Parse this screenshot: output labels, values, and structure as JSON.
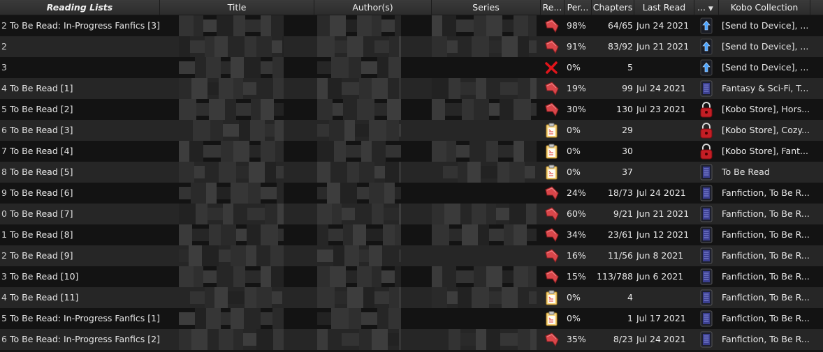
{
  "columns": {
    "reading_lists": "Reading Lists",
    "title": "Title",
    "authors": "Author(s)",
    "series": "Series",
    "read": "Re...",
    "percent": "Per...",
    "chapters": "Chapters",
    "last_read": "Last Read",
    "device": "...",
    "collection": "Kobo Collection"
  },
  "rows": [
    {
      "num": "2",
      "list": "To Be Read: In-Progress Fanfics [3]",
      "status": "bookmark",
      "percent": "98%",
      "chapters": "64/65",
      "last_read": "Jun 24 2021",
      "device": "send",
      "collection": "[Send to Device], ..."
    },
    {
      "num": "2",
      "list": "",
      "status": "bookmark",
      "percent": "91%",
      "chapters": "83/92",
      "last_read": "Jun 21 2021",
      "device": "send",
      "collection": "[Send to Device], ..."
    },
    {
      "num": "3",
      "list": "",
      "status": "cross",
      "percent": "0%",
      "chapters": "5",
      "last_read": "",
      "device": "send",
      "collection": "[Send to Device], ..."
    },
    {
      "num": "4",
      "list": "To Be Read [1]",
      "status": "bookmark",
      "percent": "19%",
      "chapters": "99",
      "last_read": "Jul 24 2021",
      "device": "ereader",
      "collection": "Fantasy & Sci-Fi, T..."
    },
    {
      "num": "5",
      "list": "To Be Read [2]",
      "status": "bookmark",
      "percent": "30%",
      "chapters": "130",
      "last_read": "Jul 23 2021",
      "device": "lock",
      "collection": "[Kobo Store], Hors..."
    },
    {
      "num": "6",
      "list": "To Be Read [3]",
      "status": "clipboard",
      "percent": "0%",
      "chapters": "29",
      "last_read": "",
      "device": "lock",
      "collection": "[Kobo Store], Cozy..."
    },
    {
      "num": "7",
      "list": "To Be Read [4]",
      "status": "clipboard",
      "percent": "0%",
      "chapters": "30",
      "last_read": "",
      "device": "lock",
      "collection": "[Kobo Store], Fant..."
    },
    {
      "num": "8",
      "list": "To Be Read [5]",
      "status": "clipboard",
      "percent": "0%",
      "chapters": "37",
      "last_read": "",
      "device": "ereader",
      "collection": "To Be Read"
    },
    {
      "num": "9",
      "list": "To Be Read [6]",
      "status": "bookmark",
      "percent": "24%",
      "chapters": "18/73",
      "last_read": "Jul 24 2021",
      "device": "ereader",
      "collection": "Fanfiction, To Be R..."
    },
    {
      "num": "0",
      "list": "To Be Read [7]",
      "status": "bookmark",
      "percent": "60%",
      "chapters": "9/21",
      "last_read": "Jun 21 2021",
      "device": "ereader",
      "collection": "Fanfiction, To Be R..."
    },
    {
      "num": "1",
      "list": "To Be Read [8]",
      "status": "bookmark",
      "percent": "34%",
      "chapters": "23/61",
      "last_read": "Jun 12 2021",
      "device": "ereader",
      "collection": "Fanfiction, To Be R..."
    },
    {
      "num": "2",
      "list": "To Be Read [9]",
      "status": "bookmark",
      "percent": "16%",
      "chapters": "11/56",
      "last_read": "Jun 8 2021",
      "device": "ereader",
      "collection": "Fanfiction, To Be R..."
    },
    {
      "num": "3",
      "list": "To Be Read [10]",
      "status": "bookmark",
      "percent": "15%",
      "chapters": "113/788",
      "last_read": "Jun 6 2021",
      "device": "ereader",
      "collection": "Fanfiction, To Be R..."
    },
    {
      "num": "4",
      "list": "To Be Read [11]",
      "status": "clipboard",
      "percent": "0%",
      "chapters": "4",
      "last_read": "",
      "device": "ereader",
      "collection": "Fanfiction, To Be R..."
    },
    {
      "num": "5",
      "list": "To Be Read: In-Progress Fanfics [1]",
      "status": "clipboard",
      "percent": "0%",
      "chapters": "1",
      "last_read": "Jul 17 2021",
      "device": "ereader",
      "collection": "Fanfiction, To Be R..."
    },
    {
      "num": "6",
      "list": "To Be Read: In-Progress Fanfics [2]",
      "status": "bookmark",
      "percent": "35%",
      "chapters": "8/23",
      "last_read": "Jul 24 2021",
      "device": "ereader",
      "collection": "Fanfiction, To Be R..."
    }
  ]
}
